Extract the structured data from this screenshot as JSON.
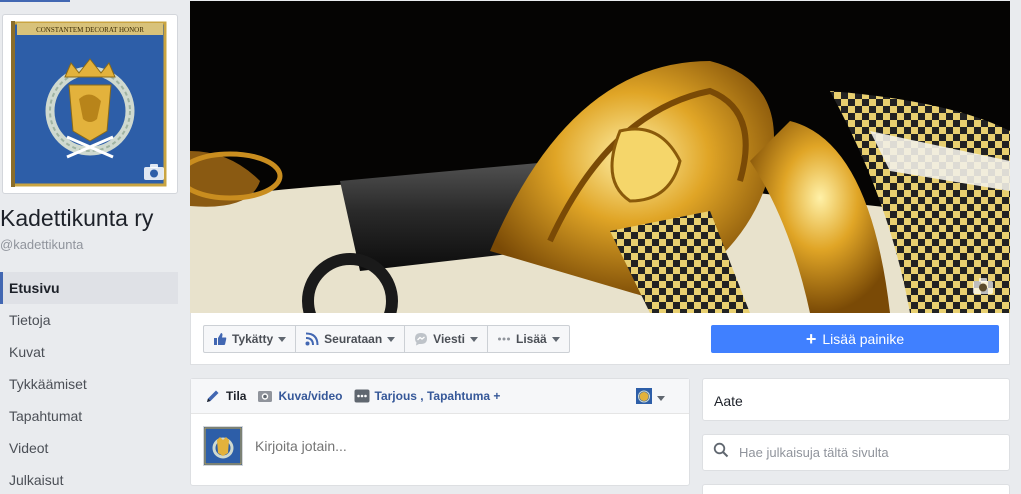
{
  "page": {
    "name": "Kadettikunta ry",
    "handle": "@kadettikunta",
    "banner_motto": "CONSTANTEM DECORAT HONOR"
  },
  "nav": {
    "items": [
      {
        "label": "Etusivu",
        "active": true
      },
      {
        "label": "Tietoja"
      },
      {
        "label": "Kuvat"
      },
      {
        "label": "Tykkäämiset"
      },
      {
        "label": "Tapahtumat"
      },
      {
        "label": "Videot"
      },
      {
        "label": "Julkaisut"
      }
    ]
  },
  "actions": {
    "like": "Tykätty",
    "follow": "Seurataan",
    "message": "Viesti",
    "more": "Lisää",
    "add_button": "Lisää painike"
  },
  "composer": {
    "tabs": [
      {
        "label": "Tila",
        "icon": "pencil-icon"
      },
      {
        "label": "Kuva/video",
        "icon": "camera-icon"
      },
      {
        "label": "Tarjous , Tapahtuma +",
        "icon": "more-dots-icon"
      }
    ],
    "placeholder": "Kirjoita jotain..."
  },
  "sidebar_right": {
    "aate": "Aate",
    "search_placeholder": "Hae julkaisuja tältä sivulta"
  },
  "colors": {
    "accent": "#4267b2",
    "button_blue": "#4080ff",
    "flag_blue": "#2d5ea8",
    "emblem_gold": "#e3b23c"
  }
}
